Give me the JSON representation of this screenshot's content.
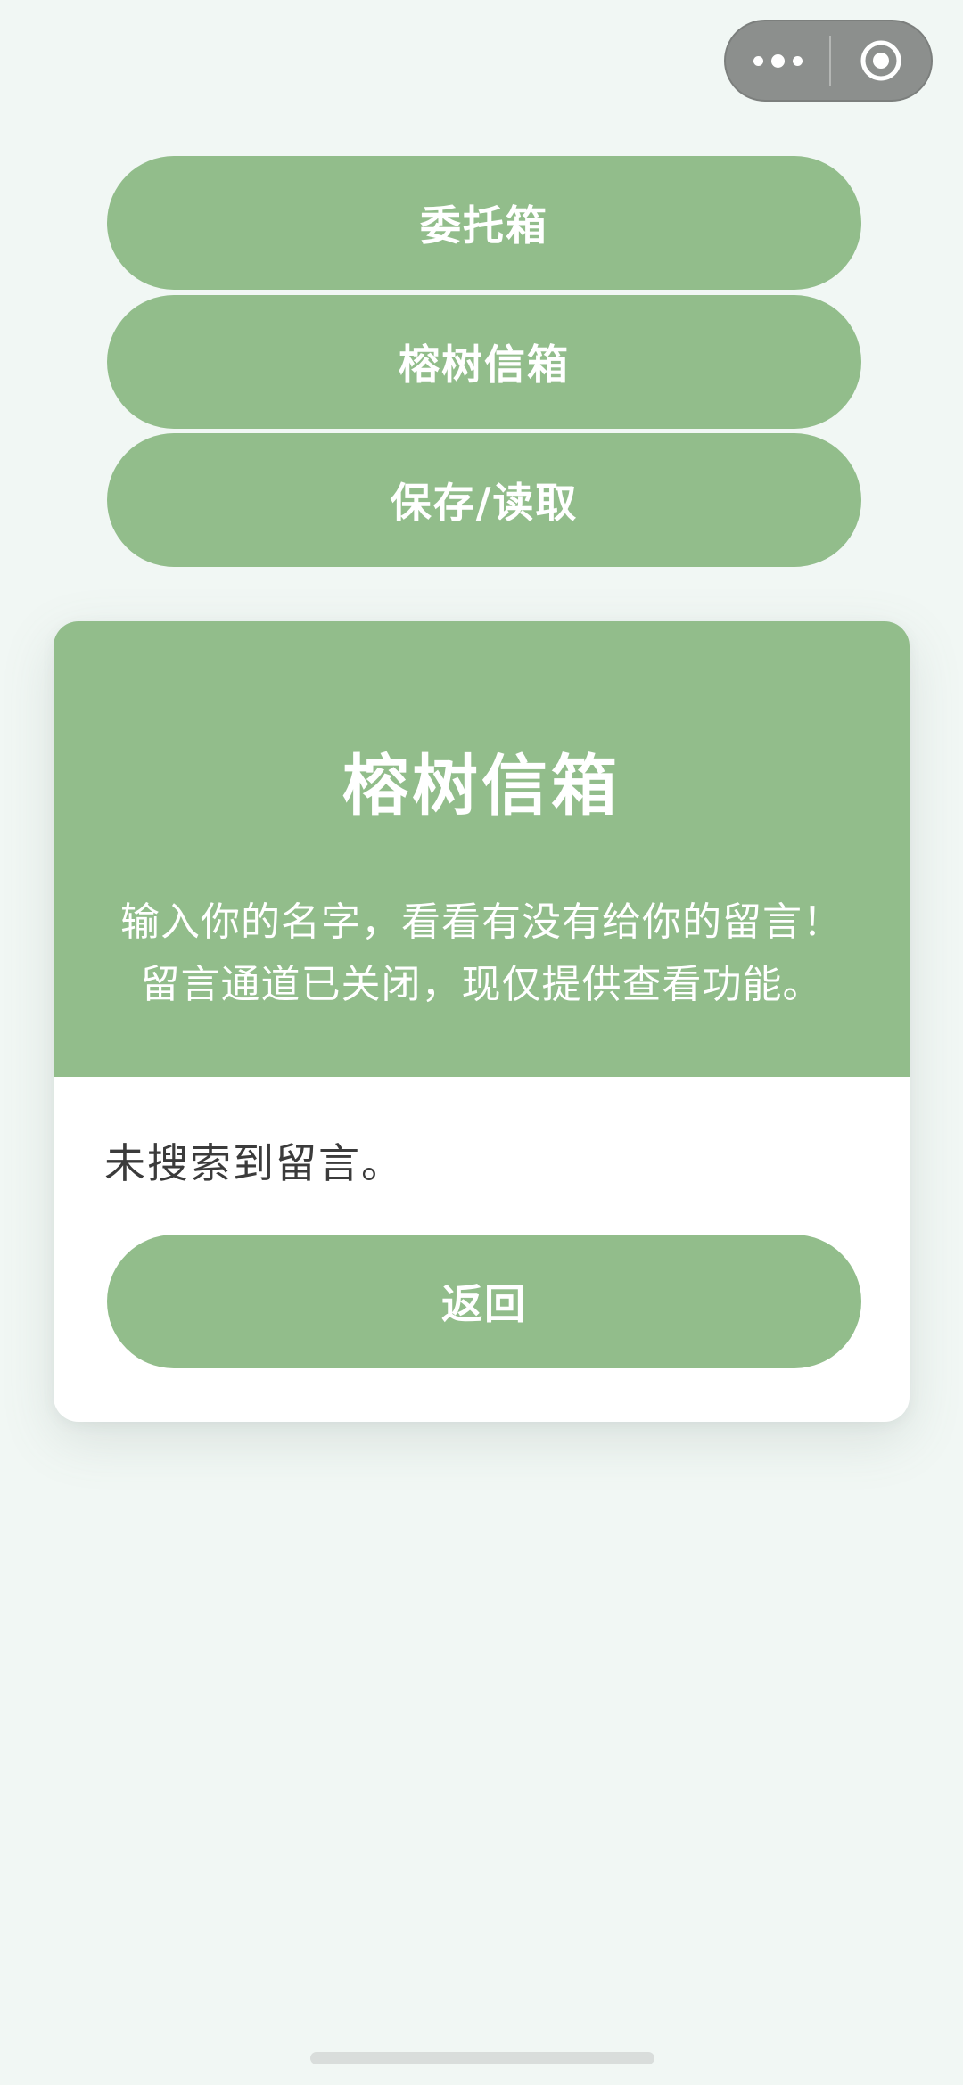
{
  "capsule": {
    "more_icon": "more-dots-icon",
    "close_icon": "target-circle-icon"
  },
  "menu": {
    "items": [
      {
        "label": "委托箱"
      },
      {
        "label": "榕树信箱"
      },
      {
        "label": "保存/读取"
      }
    ]
  },
  "card": {
    "title": "榕树信箱",
    "description_lines": [
      "输入你的名字，看看有没有给你的留言！",
      "留言通道已关闭，现仅提供查看功能。"
    ],
    "result": "未搜索到留言。",
    "back_label": "返回"
  },
  "colors": {
    "accent": "#92bd8b",
    "background": "#f1f7f4",
    "capsule": "#8c8f8d"
  }
}
